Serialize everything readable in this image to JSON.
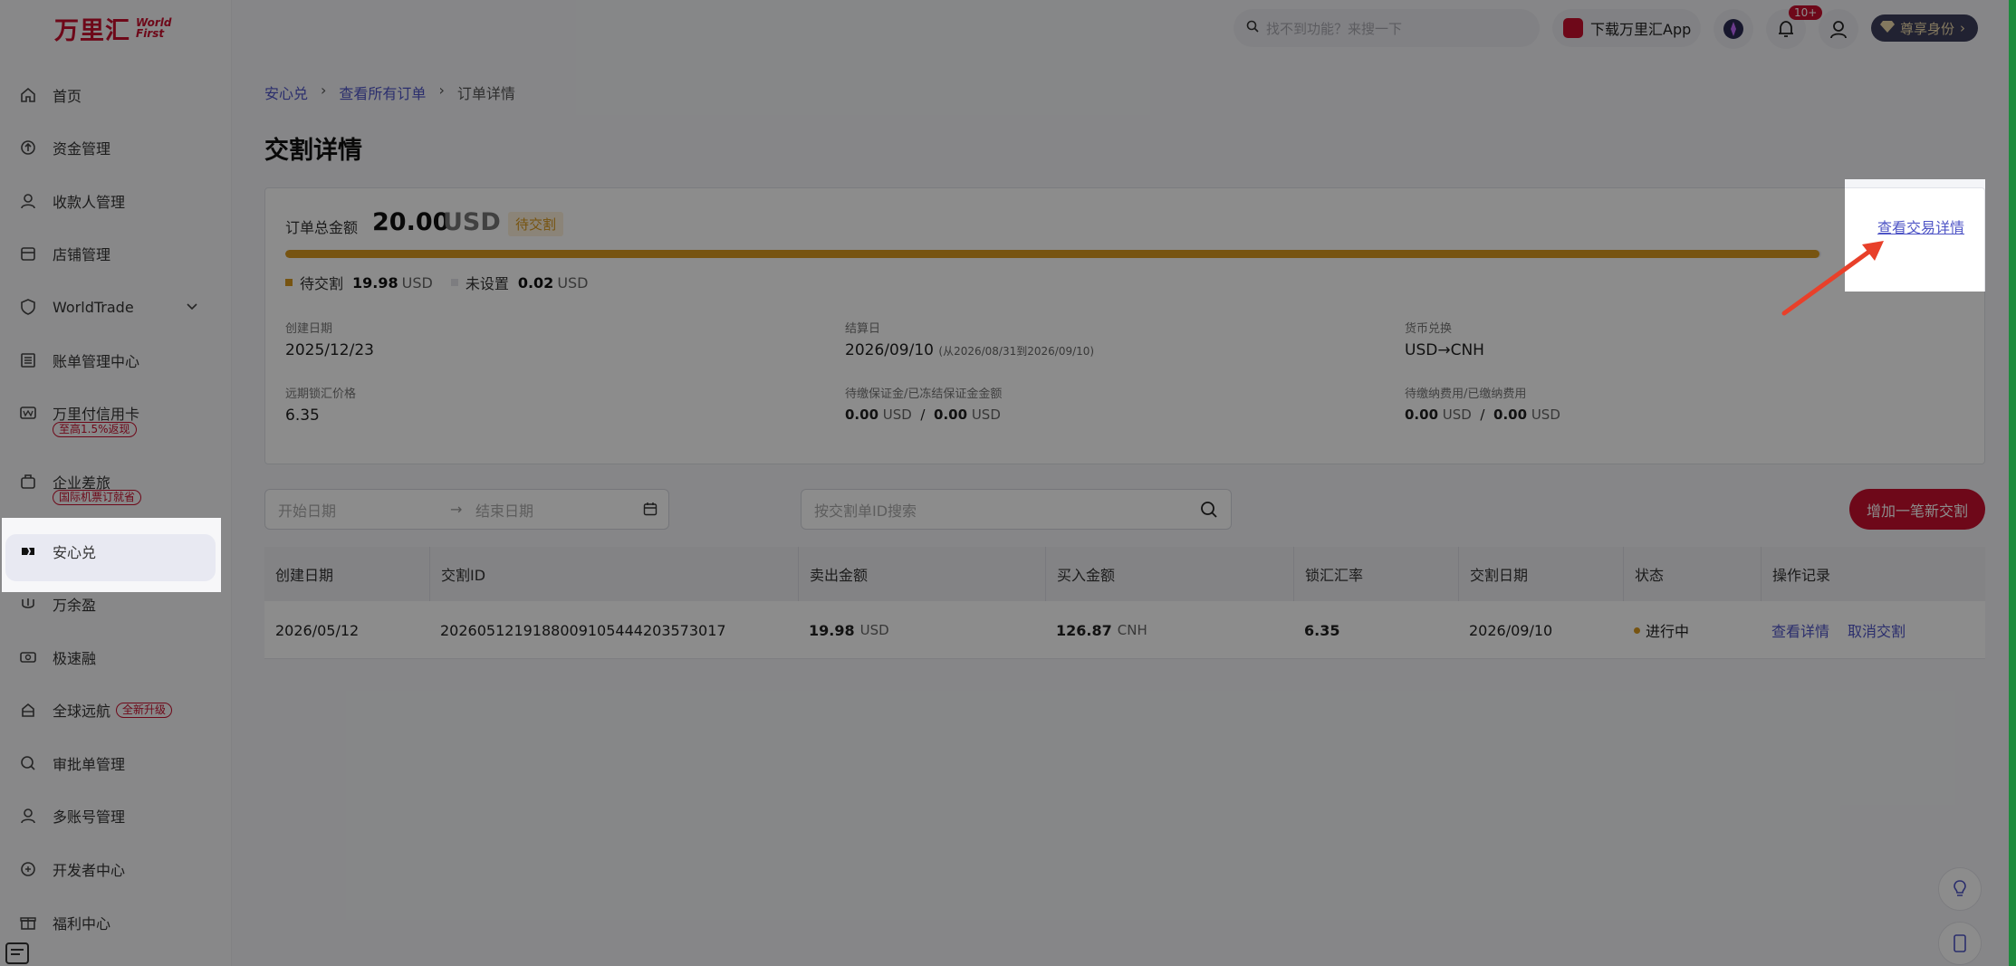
{
  "brand": {
    "cn": "万里汇",
    "en_line1": "World",
    "en_line2": "First"
  },
  "sidebar": {
    "items": [
      {
        "label": "首页",
        "icon": "home-icon"
      },
      {
        "label": "资金管理",
        "icon": "funds-icon"
      },
      {
        "label": "收款人管理",
        "icon": "payee-icon"
      },
      {
        "label": "店铺管理",
        "icon": "store-icon"
      },
      {
        "label": "WorldTrade",
        "icon": "shield-icon"
      },
      {
        "label": "账单管理中心",
        "icon": "bill-icon"
      },
      {
        "label": "万里付信用卡",
        "icon": "card-icon",
        "badge": "至高1.5%返现"
      },
      {
        "label": "企业差旅",
        "icon": "travel-icon",
        "badge": "国际机票订就省"
      },
      {
        "label": "安心兑",
        "icon": "exchange-icon"
      },
      {
        "label": "万余盈",
        "icon": "yield-icon"
      },
      {
        "label": "极速融",
        "icon": "finance-icon"
      },
      {
        "label": "全球远航",
        "icon": "global-icon",
        "badge": "全新升级"
      },
      {
        "label": "审批单管理",
        "icon": "approval-icon"
      },
      {
        "label": "多账号管理",
        "icon": "accounts-icon"
      },
      {
        "label": "开发者中心",
        "icon": "developer-icon"
      },
      {
        "label": "福利中心",
        "icon": "gift-icon"
      }
    ]
  },
  "topbar": {
    "search_placeholder": "找不到功能？来搜一下",
    "app_label": "下载万里汇App",
    "notif_count": "10+",
    "vip_label": "尊享身份"
  },
  "breadcrumb": {
    "item1": "安心兑",
    "item2": "查看所有订单",
    "item3": "订单详情"
  },
  "page_title": "交割详情",
  "summary": {
    "total_label": "订单总金额",
    "total_amount": "20.00",
    "total_currency": "USD",
    "status": "待交割",
    "view_link": "查看交易详情",
    "progress_fraction": 0.999,
    "legend_pending_label": "待交割",
    "legend_pending_amount": "19.98",
    "legend_pending_currency": "USD",
    "legend_unset_label": "未设置",
    "legend_unset_amount": "0.02",
    "legend_unset_currency": "USD",
    "accent_color": "#d99a1f"
  },
  "fields": {
    "created_label": "创建日期",
    "created_value": "2025/12/23",
    "settle_label": "结算日",
    "settle_value": "2026/09/10",
    "settle_range": "(从2026/08/31到2026/09/10)",
    "fx_label": "货币兑换",
    "fx_value": "USD→CNH",
    "rate_label": "远期锁汇价格",
    "rate_value": "6.35",
    "margin_label": "待缴保证金/已冻结保证金金额",
    "margin_a": "0.00",
    "margin_a_cur": "USD",
    "margin_sep": "/",
    "margin_b": "0.00",
    "margin_b_cur": "USD",
    "fee_label": "待缴纳费用/已缴纳费用",
    "fee_a": "0.00",
    "fee_a_cur": "USD",
    "fee_sep": "/",
    "fee_b": "0.00",
    "fee_b_cur": "USD"
  },
  "filters": {
    "start_placeholder": "开始日期",
    "end_placeholder": "结束日期",
    "search_placeholder": "按交割单ID搜索",
    "add_button": "增加一笔新交割"
  },
  "table": {
    "headers": [
      "创建日期",
      "交割ID",
      "卖出金额",
      "买入金额",
      "锁汇汇率",
      "交割日期",
      "状态",
      "操作记录"
    ],
    "rows": [
      {
        "created": "2026/05/12",
        "id": "2026051219188009105444203573017",
        "sell_amount": "19.98",
        "sell_cur": "USD",
        "buy_amount": "126.87",
        "buy_cur": "CNH",
        "rate": "6.35",
        "date": "2026/09/10",
        "status": "进行中",
        "action1": "查看详情",
        "action2": "取消交割"
      }
    ]
  }
}
